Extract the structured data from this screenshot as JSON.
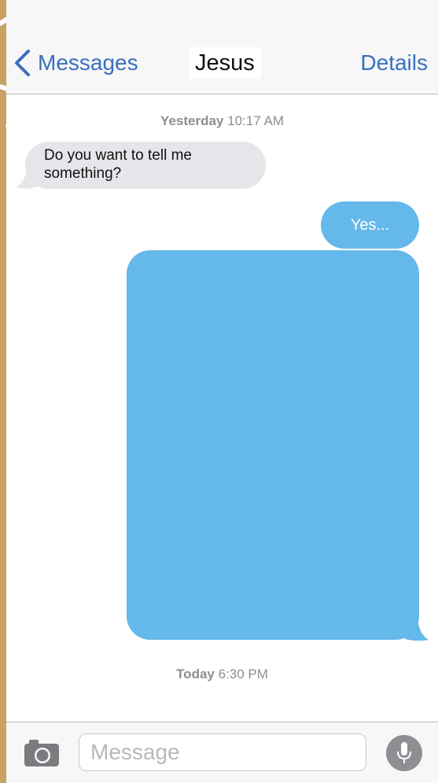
{
  "navbar": {
    "back_label": "Messages",
    "title": "Jesus",
    "details_label": "Details"
  },
  "thread": {
    "timestamp_1": {
      "day": "Yesterday",
      "time": "10:17 AM"
    },
    "incoming_message": "Do you want to tell me something?",
    "outgoing_message": "Yes...",
    "outgoing_long_message": "",
    "timestamp_2": {
      "day": "Today",
      "time": "6:30 PM"
    }
  },
  "input_bar": {
    "placeholder": "Message"
  },
  "icons": {
    "back": "chevron-left-icon",
    "camera": "camera-icon",
    "mic": "microphone-icon"
  },
  "colors": {
    "accent": "#3a6fbf",
    "outgoing_bubble": "#64b8ea",
    "incoming_bubble": "#e5e5ea",
    "timestamp": "#8e8e93"
  }
}
